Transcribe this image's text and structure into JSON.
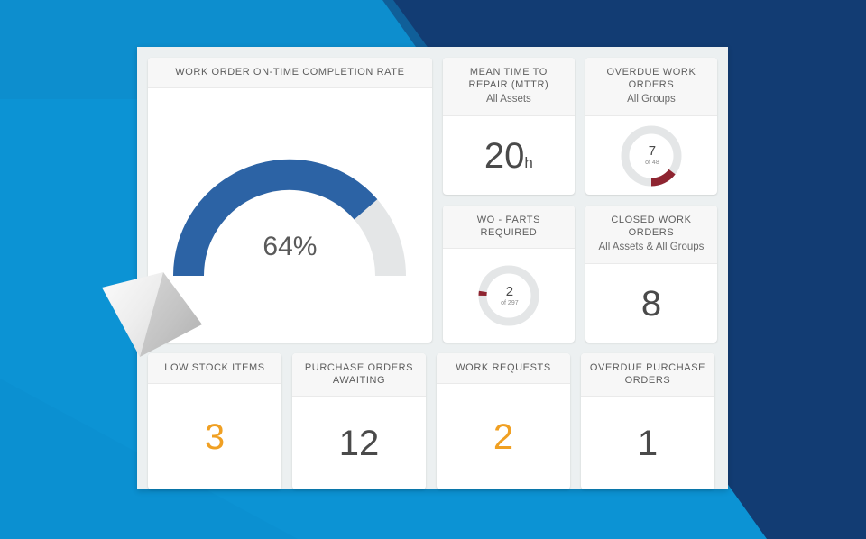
{
  "theme": {
    "background_navy": "#123C73",
    "background_blue": "#0C93D4",
    "panel_bg": "#ECF0F1",
    "card_bg": "#FFFFFF",
    "card_header_bg": "#F7F7F7",
    "gauge_fill": "#2C63A5",
    "gauge_track": "#E4E6E7",
    "donut_fill": "#8E2430",
    "donut_track": "#E4E6E7",
    "value_color": "#4A4A4A",
    "accent_orange": "#F0A023"
  },
  "cards": {
    "completion_rate": {
      "title": "WORK ORDER ON-TIME COMPLETION RATE",
      "value_label": "64%"
    },
    "mttr": {
      "title": "MEAN TIME TO REPAIR (MTTR)",
      "subtitle": "All Assets",
      "value": "20",
      "unit": "h"
    },
    "overdue_work_orders": {
      "title": "OVERDUE WORK ORDERS",
      "subtitle": "All Groups",
      "value": "7",
      "of_label": "of 48"
    },
    "wo_parts_required": {
      "title": "WO - PARTS REQUIRED",
      "value": "2",
      "of_label": "of 297"
    },
    "closed_work_orders": {
      "title": "CLOSED WORK ORDERS",
      "subtitle": "All Assets & All Groups",
      "value": "8"
    },
    "low_stock_items": {
      "title": "LOW STOCK ITEMS",
      "value": "3"
    },
    "purchase_orders_awaiting": {
      "title": "PURCHASE ORDERS AWAITING",
      "value": "12"
    },
    "work_requests": {
      "title": "WORK REQUESTS",
      "value": "2"
    },
    "overdue_purchase_orders": {
      "title": "OVERDUE PURCHASE ORDERS",
      "value": "1"
    }
  },
  "chart_data": [
    {
      "type": "gauge",
      "title": "WORK ORDER ON-TIME COMPLETION RATE",
      "value": 64,
      "max": 100,
      "unit": "%",
      "start_angle": 180,
      "sweep_angle": 180,
      "fill_color": "#2C63A5",
      "track_color": "#E4E6E7"
    },
    {
      "type": "pie",
      "title": "OVERDUE WORK ORDERS",
      "value": 7,
      "total": 48,
      "percent": 14.6,
      "fill_color": "#8E2430",
      "track_color": "#E4E6E7"
    },
    {
      "type": "pie",
      "title": "WO - PARTS REQUIRED",
      "value": 2,
      "total": 297,
      "percent": 0.7,
      "fill_color": "#8E2430",
      "track_color": "#E4E6E7"
    }
  ]
}
